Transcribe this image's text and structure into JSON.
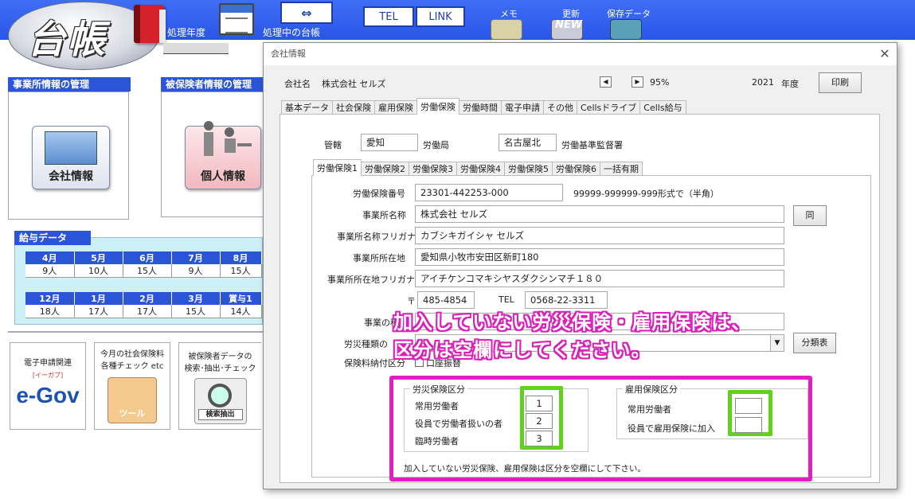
{
  "app": {
    "logo_text": "台帳",
    "shori_nendo_label": "処理年度",
    "shori_daicho_label": "処理中の台帳",
    "tel_label": "TEL",
    "link_label": "LINK",
    "memo_label": "メモ",
    "update_label": "更新",
    "update_badge": "NEW",
    "save_label": "保存データ"
  },
  "left": {
    "office_mgmt_header": "事業所情報の管理",
    "insured_mgmt_header": "被保険者情報の管理",
    "company_info_btn": "会社情報",
    "personal_info_btn": "個人情報",
    "salary_header": "給与データ",
    "salary_row1": {
      "months": [
        "4月",
        "5月",
        "6月",
        "7月",
        "8月"
      ],
      "counts": [
        "9人",
        "10人",
        "15人",
        "9人",
        "15人"
      ]
    },
    "salary_row2": {
      "months": [
        "12月",
        "1月",
        "2月",
        "3月",
        "賞与1"
      ],
      "counts": [
        "18人",
        "17人",
        "17人",
        "15人",
        "14人"
      ]
    },
    "card1_title": "電子申請関連",
    "card1_logo": "e-Gov",
    "card1_logo_sub": "[イーガブ]",
    "card2_title_line1": "今月の社会保険料",
    "card2_title_line2": "各種チェック etc",
    "card2_tool_label": "ツール",
    "card3_title_line1": "被保険者データの",
    "card3_title_line2": "検索･抽出･チェック",
    "card3_button": "検索抽出"
  },
  "dialog": {
    "title": "会社情報",
    "company_label": "会社名",
    "company_name": "株式会社 セルズ",
    "zoom": "95%",
    "year": "2021",
    "year_suffix": "年度",
    "print_btn": "印刷",
    "main_tabs": [
      "基本データ",
      "社会保険",
      "雇用保険",
      "労働保険",
      "労働時間",
      "電子申請",
      "その他",
      "Cellsドライブ",
      "Cells給与"
    ],
    "kankatsu_label": "管轄",
    "kankatsu_value": "愛知",
    "roudoukyoku_label": "労働局",
    "kantokusho_value": "名古屋北",
    "kantokusho_label": "労働基準監督署",
    "sub_tabs": [
      "労働保険1",
      "労働保険2",
      "労働保険3",
      "労働保険4",
      "労働保険5",
      "労働保険6",
      "一括有期"
    ],
    "hoken_bango_label": "労働保険番号",
    "hoken_bango_value": "23301-442253-000",
    "hoken_bango_hint": "99999-999999-999形式で（半角）",
    "jigyosho_name_label": "事業所名称",
    "jigyosho_name_value": "株式会社 セルズ",
    "same_btn": "同",
    "jigyosho_kana_label": "事業所名称フリガナ",
    "jigyosho_kana_value": "カブシキガイシャ セルズ",
    "jigyosho_addr_label": "事業所所在地",
    "jigyosho_addr_value": "愛知県小牧市安田区新町180",
    "jigyosho_addr_kana_label": "事業所所在地フリガナ",
    "jigyosho_addr_kana_value": "アイチケンコマキシヤスダクシンマチ１８０",
    "postal_mark": "〒",
    "postal_value": "485-4854",
    "tel_label": "TEL",
    "tel_value": "0568-22-3311",
    "jigyo_shurui_label": "事業の種類",
    "rousai_shurui_label": "労災種類の",
    "bunrui_btn": "分類表",
    "nofu_label": "保険料納付区分",
    "koza_label": "口座振替",
    "rousai_group_title": "労災保険区分",
    "rousai_items": [
      "常用労働者",
      "役員で労働者扱いの者",
      "臨時労働者"
    ],
    "rousai_values": [
      "1",
      "2",
      "3"
    ],
    "koyo_group_title": "雇用保険区分",
    "koyo_items": [
      "常用労働者",
      "役員で雇用保険に加入"
    ],
    "koyo_values": [
      "",
      ""
    ],
    "footer_note": "加入していない労災保険、雇用保険は区分を空欄にして下さい。"
  },
  "annotation": {
    "line1": "加入していない労災保険・雇用保険は、",
    "line2": "区分は空欄にしてください。",
    "colors": {
      "highlight_magenta": "#e21fc2",
      "highlight_green": "#5fd21c"
    }
  }
}
